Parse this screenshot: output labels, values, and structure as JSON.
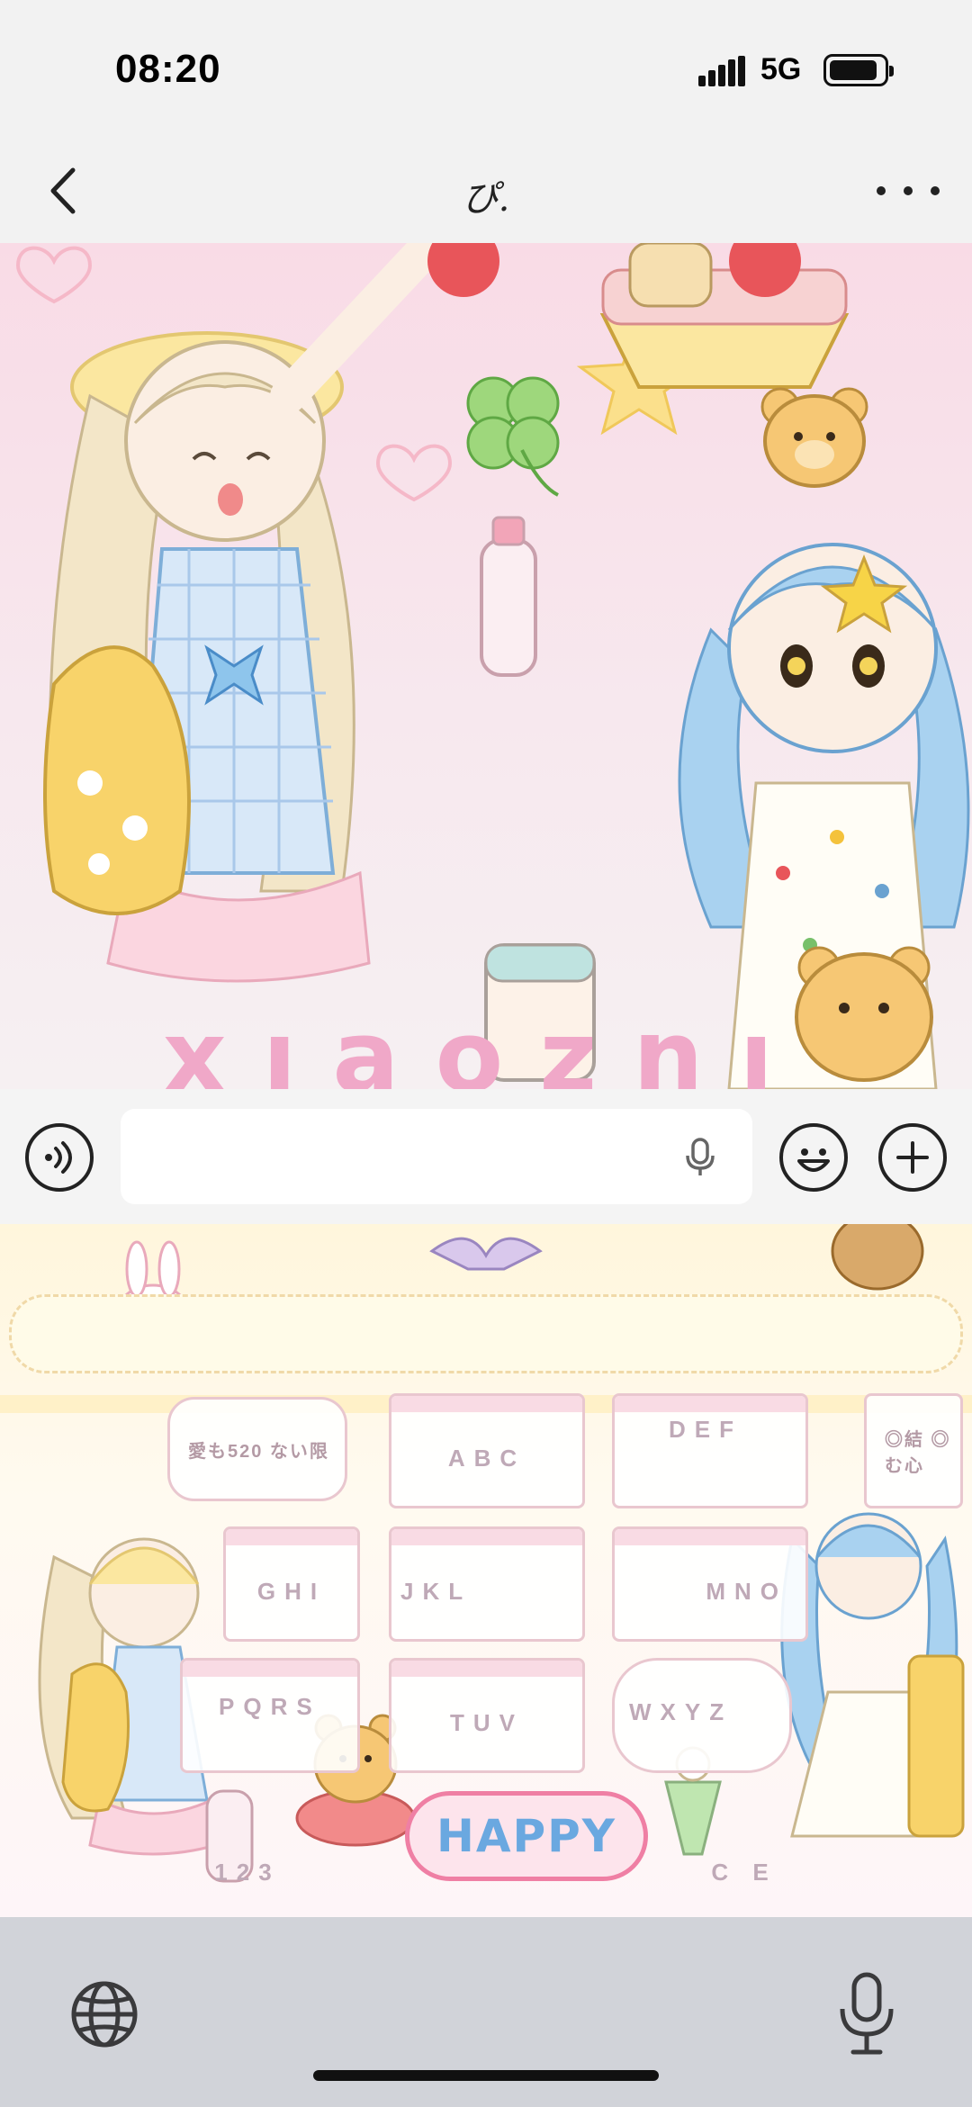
{
  "status_bar": {
    "time": "08:20",
    "network": "5G"
  },
  "nav": {
    "title": "ぴ."
  },
  "wallpaper": {
    "caption": "xiaozhi"
  },
  "input": {
    "value": "",
    "placeholder": ""
  },
  "keyboard": {
    "keys": {
      "top_left": "愛も520 ない限",
      "abc": "ABC",
      "def": "DEF",
      "top_right": "◎結 ◎む心",
      "ghi": "GHI",
      "jkl": "JKL",
      "mno": "MNO",
      "pqrs": "PQRS",
      "tuv": "TUV",
      "wxyz": "WXYZ",
      "num": "123",
      "happy": "HAPPY",
      "delete": "C E"
    }
  },
  "icons": {
    "back": "chevron-left-icon",
    "more": "more-icon",
    "voice": "voice-icon",
    "mic": "microphone-icon",
    "emoji": "emoji-icon",
    "plus": "plus-icon",
    "globe": "globe-icon"
  },
  "colors": {
    "wallpaper_pink": "#f9dbe6",
    "happy_text": "#6aa8e0",
    "happy_border": "#ef7fa4"
  }
}
